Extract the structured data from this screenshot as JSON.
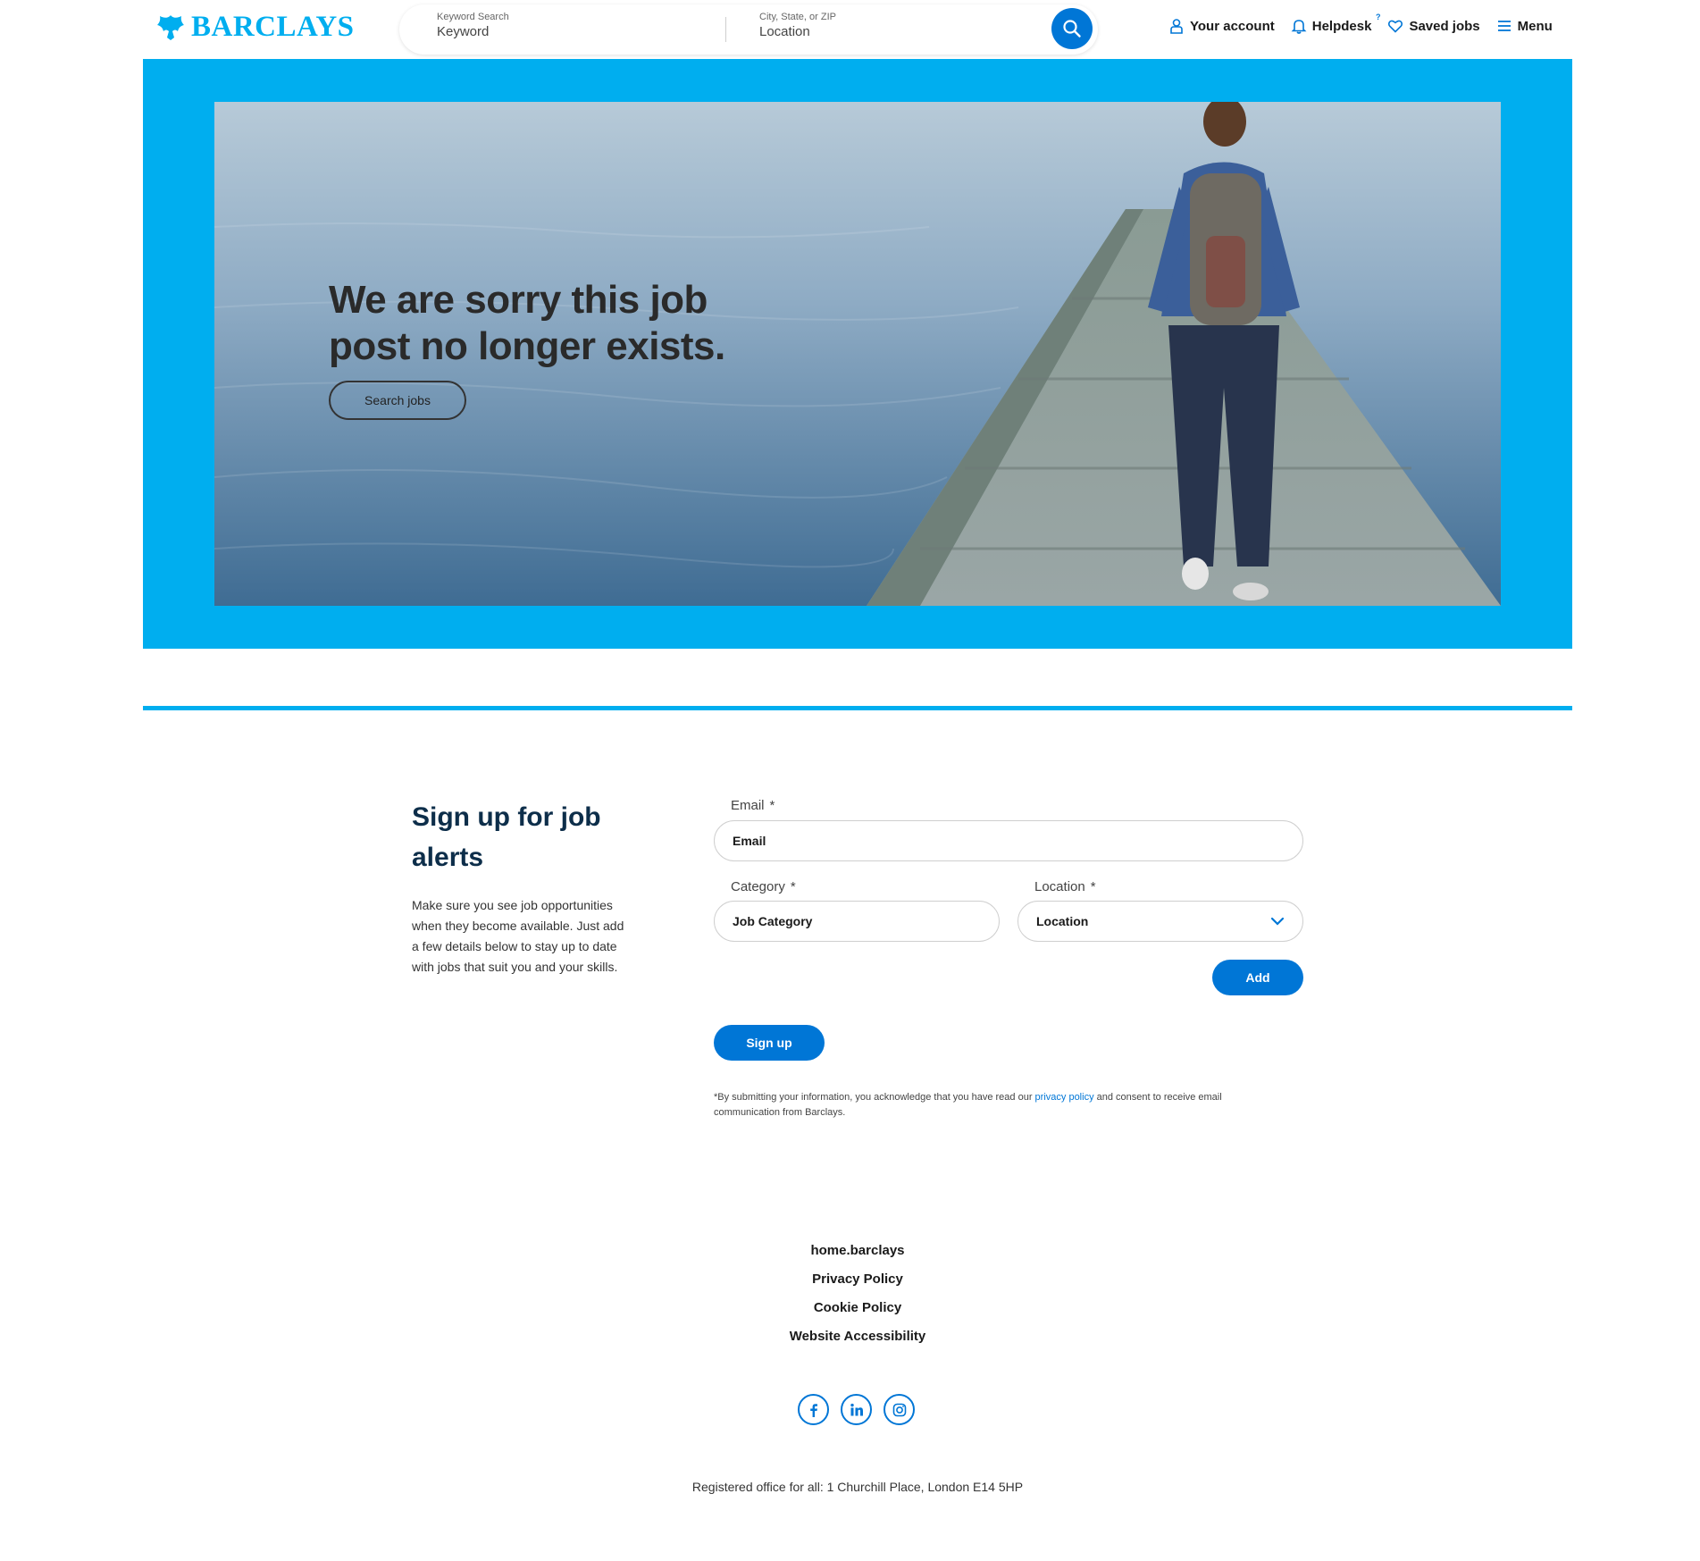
{
  "brand": {
    "logo_text": "BARCLAYS",
    "color": "#00AEEF",
    "accent": "#0076D6"
  },
  "search": {
    "keyword_label": "Keyword Search",
    "keyword_placeholder": "Keyword",
    "location_label": "City, State, or ZIP",
    "location_placeholder": "Location",
    "button_icon": "search-icon"
  },
  "nav": {
    "account": "Your account",
    "helpdesk": "Helpdesk",
    "helpdesk_badge": "?",
    "saved": "Saved jobs",
    "menu": "Menu"
  },
  "hero": {
    "title": "We are sorry this job post no longer exists.",
    "button": "Search jobs"
  },
  "signup": {
    "title": "Sign up for job alerts",
    "description": "Make sure you see job opportunities when they become available. Just add a few details below to stay up to date with jobs that suit you and your skills.",
    "email_label": "Email",
    "email_placeholder": "Email",
    "category_label": "Category",
    "category_placeholder": "Job Category",
    "location_label": "Location",
    "location_value": "Location",
    "required_mark": "*",
    "add_button": "Add",
    "signup_button": "Sign up",
    "legal_prefix": "*By submitting your information, you acknowledge that you have read our ",
    "legal_link": "privacy policy",
    "legal_suffix": " and consent to receive email communication from Barclays."
  },
  "footer": {
    "links": [
      "home.barclays",
      "Privacy Policy",
      "Cookie Policy",
      "Website Accessibility"
    ],
    "social": [
      "facebook-icon",
      "linkedin-icon",
      "instagram-icon"
    ],
    "office": "Registered office for all: 1 Churchill Place, London E14 5HP"
  }
}
